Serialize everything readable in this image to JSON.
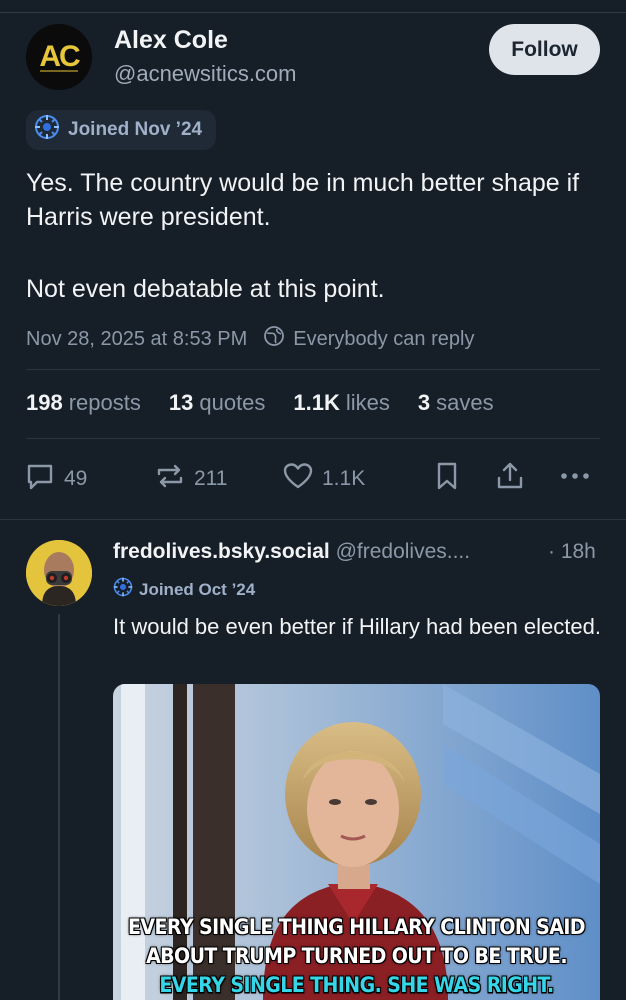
{
  "post": {
    "author_name": "Alex Cole",
    "author_handle": "@acnewsitics.com",
    "avatar_letters": "AC",
    "follow_label": "Follow",
    "joined": "Joined Nov ’24",
    "text_para_1": "Yes. The country would be in much better shape if Harris were president.",
    "text_para_2": "Not even debatable at this point.",
    "timestamp": "Nov 28, 2025 at 8:53 PM",
    "reply_setting": "Everybody can reply"
  },
  "stats": {
    "reposts_count": "198",
    "reposts_label": "reposts",
    "quotes_count": "13",
    "quotes_label": "quotes",
    "likes_count": "1.1K",
    "likes_label": "likes",
    "saves_count": "3",
    "saves_label": "saves"
  },
  "actions": {
    "replies": "49",
    "reposts": "211",
    "likes": "1.1K"
  },
  "reply": {
    "name": "fredolives.bsky.social",
    "handle": "@fredolives....",
    "time": "· 18h",
    "joined": "Joined Oct ’24",
    "text": "It would be even better if Hillary had been elected.",
    "caption_line1": "EVERY SINGLE THING HILLARY CLINTON SAID",
    "caption_line2": "ABOUT TRUMP TURNED OUT TO BE TRUE.",
    "caption_line3": "EVERY SINGLE THING. SHE WAS RIGHT."
  },
  "colors": {
    "background": "#161e27",
    "text": "#f1f3f5",
    "muted": "#8b98a8",
    "joined_badge": "#9fb0c8",
    "logo_gold": "#e8c63a",
    "caption_cyan": "#35d6e8"
  },
  "icons": [
    "globe-icon",
    "reply-icon",
    "repost-icon",
    "like-icon",
    "bookmark-icon",
    "share-icon",
    "more-icon",
    "sparkle-badge-icon"
  ]
}
